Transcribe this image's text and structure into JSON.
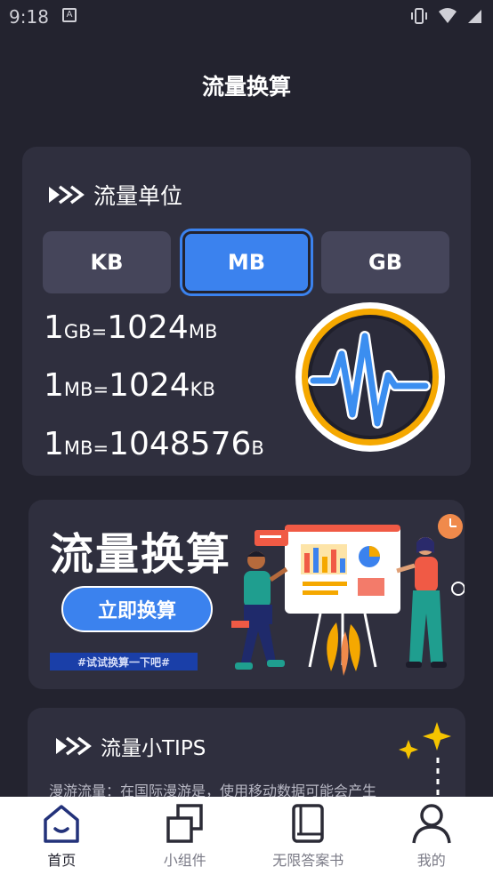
{
  "status": {
    "time": "9:18",
    "notif_letter": "A"
  },
  "page_title": "流量换算",
  "unit_section": {
    "title": "流量单位",
    "buttons": [
      {
        "label": "KB",
        "selected": false
      },
      {
        "label": "MB",
        "selected": true
      },
      {
        "label": "GB",
        "selected": false
      }
    ],
    "conversions": [
      {
        "lhs_num": "1",
        "lhs_unit": "GB",
        "eq": "=",
        "rhs_num": "1024",
        "rhs_unit": "MB"
      },
      {
        "lhs_num": "1",
        "lhs_unit": "MB",
        "eq": "=",
        "rhs_num": "1024",
        "rhs_unit": "KB"
      },
      {
        "lhs_num": "1",
        "lhs_unit": "MB",
        "eq": "=",
        "rhs_num": "1048576",
        "rhs_unit": "B"
      }
    ]
  },
  "banner": {
    "title": "流量换算",
    "cta_label": "立即换算",
    "tag": "#试试换算一下吧#"
  },
  "tips": {
    "title": "流量小TIPS",
    "text": "漫游流量：在国际漫游是，使用移动数据可能会产生"
  },
  "tabs": [
    {
      "label": "首页",
      "icon": "home-icon",
      "active": true
    },
    {
      "label": "小组件",
      "icon": "widgets-icon",
      "active": false
    },
    {
      "label": "无限答案书",
      "icon": "book-icon",
      "active": false
    },
    {
      "label": "我的",
      "icon": "profile-icon",
      "active": false
    }
  ],
  "colors": {
    "accent": "#3b82ee",
    "background": "#23232f",
    "card": "#2f2f3e",
    "badge_ring": "#f5a800"
  }
}
